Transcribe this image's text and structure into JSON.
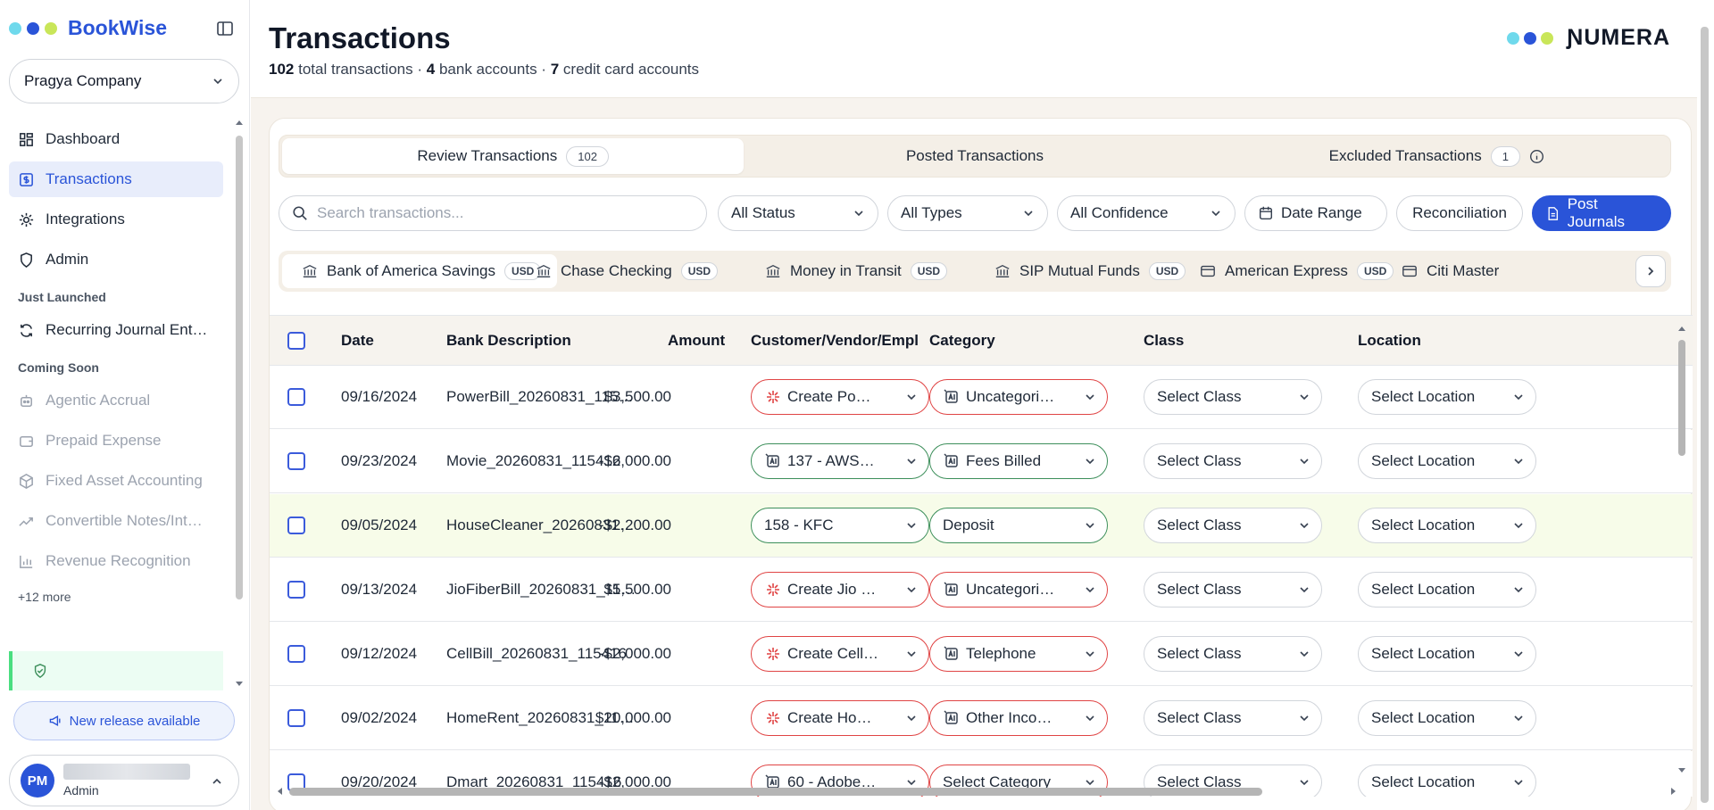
{
  "app": {
    "name": "BookWise"
  },
  "brand_colors": {
    "dot1": "#6fd9ec",
    "dot2": "#2a54d8",
    "dot3": "#c9e659",
    "primary": "#2a54d8",
    "danger": "#e04444",
    "success": "#3d8f5b"
  },
  "company": {
    "name": "Pragya Company"
  },
  "nav": {
    "items": [
      {
        "label": "Dashboard",
        "icon": "dashboard-icon"
      },
      {
        "label": "Transactions",
        "icon": "dollar-receipt-icon"
      },
      {
        "label": "Integrations",
        "icon": "gear-icon"
      },
      {
        "label": "Admin",
        "icon": "shield-icon"
      }
    ],
    "just_launched_label": "Just Launched",
    "just_launched": [
      {
        "label": "Recurring Journal Ent…",
        "icon": "refresh-icon"
      }
    ],
    "coming_soon_label": "Coming Soon",
    "coming_soon": [
      {
        "label": "Agentic Accrual",
        "icon": "bot-icon"
      },
      {
        "label": "Prepaid Expense",
        "icon": "wallet-icon"
      },
      {
        "label": "Fixed Asset Accounting",
        "icon": "box-icon"
      },
      {
        "label": "Convertible Notes/Int…",
        "icon": "trend-icon"
      },
      {
        "label": "Revenue Recognition",
        "icon": "bar-chart-icon"
      }
    ],
    "more_label": "+12 more"
  },
  "release": {
    "label": "New release available"
  },
  "user": {
    "initials": "PM",
    "role": "Admin"
  },
  "header": {
    "title": "Transactions",
    "total_count": "102",
    "total_label": "total transactions ·",
    "bank_count": "4",
    "bank_label": "bank accounts ·",
    "cc_count": "7",
    "cc_label": "credit card accounts",
    "partner_logo": "ƝUMERA"
  },
  "tabs": [
    {
      "label": "Review Transactions",
      "count": "102"
    },
    {
      "label": "Posted Transactions"
    },
    {
      "label": "Excluded Transactions",
      "count": "1"
    }
  ],
  "filters": {
    "search_placeholder": "Search transactions...",
    "status": "All Status",
    "types": "All Types",
    "confidence": "All Confidence",
    "date_range": "Date Range",
    "reconciliation": "Reconciliation",
    "post_journals": "Post Journals"
  },
  "accounts": [
    {
      "name": "Bank of America Savings",
      "currency": "USD",
      "icon": "bank-icon"
    },
    {
      "name": "Chase Checking",
      "currency": "USD",
      "icon": "bank-icon"
    },
    {
      "name": "Money in Transit",
      "currency": "USD",
      "icon": "bank-icon"
    },
    {
      "name": "SIP Mutual Funds",
      "currency": "USD",
      "icon": "bank-icon"
    },
    {
      "name": "American Express",
      "currency": "USD",
      "icon": "credit-card-icon"
    },
    {
      "name": "Citi Master",
      "currency": "",
      "icon": "credit-card-icon"
    }
  ],
  "table": {
    "columns": {
      "date": "Date",
      "desc": "Bank Description",
      "amount": "Amount",
      "cve": "Customer/Vendor/Empl",
      "category": "Category",
      "class": "Class",
      "location": "Location"
    },
    "rows": [
      {
        "date": "09/16/2024",
        "desc": "PowerBill_20260831_115…",
        "amount": "$3,500.00",
        "cve": "Create Po…",
        "cve_style": "red",
        "cve_icon": "sparkle-icon",
        "category": "Uncategori…",
        "cat_style": "red",
        "cat_icon": "ai-icon",
        "class": "Select Class",
        "location": "Select Location"
      },
      {
        "date": "09/23/2024",
        "desc": "Movie_20260831_115416",
        "amount": "-$2,000.00",
        "cve": "137 - AWS…",
        "cve_style": "green",
        "cve_icon": "ai-icon",
        "category": "Fees Billed",
        "cat_style": "green",
        "cat_icon": "ai-icon",
        "class": "Select Class",
        "location": "Select Location"
      },
      {
        "date": "09/05/2024",
        "desc": "HouseCleaner_20260831…",
        "amount": "-$2,200.00",
        "cve": "158 - KFC",
        "cve_style": "green",
        "cve_icon": "",
        "category": "Deposit",
        "cat_style": "green",
        "cat_icon": "",
        "class": "Select Class",
        "location": "Select Location"
      },
      {
        "date": "09/13/2024",
        "desc": "JioFiberBill_20260831_11…",
        "amount": "$5,500.00",
        "cve": "Create Jio …",
        "cve_style": "red",
        "cve_icon": "sparkle-icon",
        "category": "Uncategori…",
        "cat_style": "red",
        "cat_icon": "ai-icon",
        "class": "Select Class",
        "location": "Select Location"
      },
      {
        "date": "09/12/2024",
        "desc": "CellBill_20260831_115416",
        "amount": "-$2,000.00",
        "cve": "Create Cell…",
        "cve_style": "red",
        "cve_icon": "sparkle-icon",
        "category": "Telephone",
        "cat_style": "red",
        "cat_icon": "ai-icon",
        "class": "Select Class",
        "location": "Select Location"
      },
      {
        "date": "09/02/2024",
        "desc": "HomeRent_20260831_11…",
        "amount": "$20,000.00",
        "cve": "Create Ho…",
        "cve_style": "red",
        "cve_icon": "sparkle-icon",
        "category": "Other Inco…",
        "cat_style": "red",
        "cat_icon": "ai-icon",
        "class": "Select Class",
        "location": "Select Location"
      },
      {
        "date": "09/20/2024",
        "desc": "Dmart_20260831_115416",
        "amount": "-$2,000.00",
        "cve": "60 - Adobe…",
        "cve_style": "red",
        "cve_icon": "ai-icon",
        "category": "Select Category",
        "cat_style": "red",
        "cat_icon": "",
        "class": "Select Class",
        "location": "Select Location"
      }
    ]
  }
}
